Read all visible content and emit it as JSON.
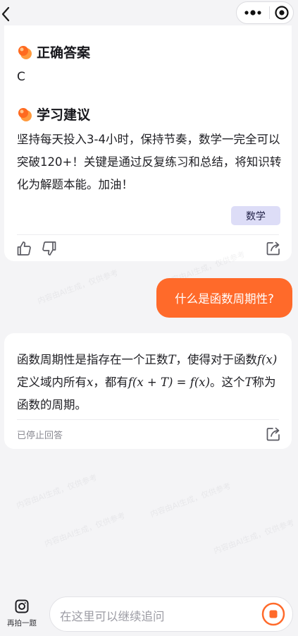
{
  "header": {
    "back_icon": "chevron-left-icon",
    "more_icon": "more-dots-icon",
    "target_icon": "target-icon"
  },
  "card1": {
    "correct_answer_title": "正确答案",
    "correct_answer_value": "C",
    "advice_title": "学习建议",
    "advice_text": "坚持每天投入3-4小时，保持节奏，数学一完全可以突破120+！关键是通过反复练习和总结，将知识转化为解题本能。加油！",
    "subject_tag": "数学",
    "actions": [
      "thumbs-up-icon",
      "thumbs-down-icon",
      "share-icon"
    ]
  },
  "user_message": "什么是函数周期性?",
  "card2": {
    "reply_segments": [
      {
        "t": "函数周期性是指存在一个正数",
        "math": false
      },
      {
        "t": "T",
        "math": true
      },
      {
        "t": "，使得对于函数",
        "math": false
      },
      {
        "t": "f(x)",
        "math": true
      },
      {
        "t": "定义域内所有",
        "math": false
      },
      {
        "t": "x",
        "math": true
      },
      {
        "t": "，都有",
        "math": false
      },
      {
        "t": "f(x + T) = f(x)",
        "math": true
      },
      {
        "t": "。这个",
        "math": false
      },
      {
        "t": "T",
        "math": true
      },
      {
        "t": "称为函数的周期。",
        "math": false
      }
    ],
    "status": "已停止回答",
    "action_icon": "share-icon"
  },
  "watermark": "内容由AI生成，仅供参考",
  "bottom": {
    "retake_label": "再拍一题",
    "input_placeholder": "在这里可以继续追问",
    "stop_icon": "stop-icon"
  },
  "colors": {
    "accent": "#ff6a2a",
    "tag_bg": "#ddddf7",
    "background": "#f4f4f6"
  }
}
